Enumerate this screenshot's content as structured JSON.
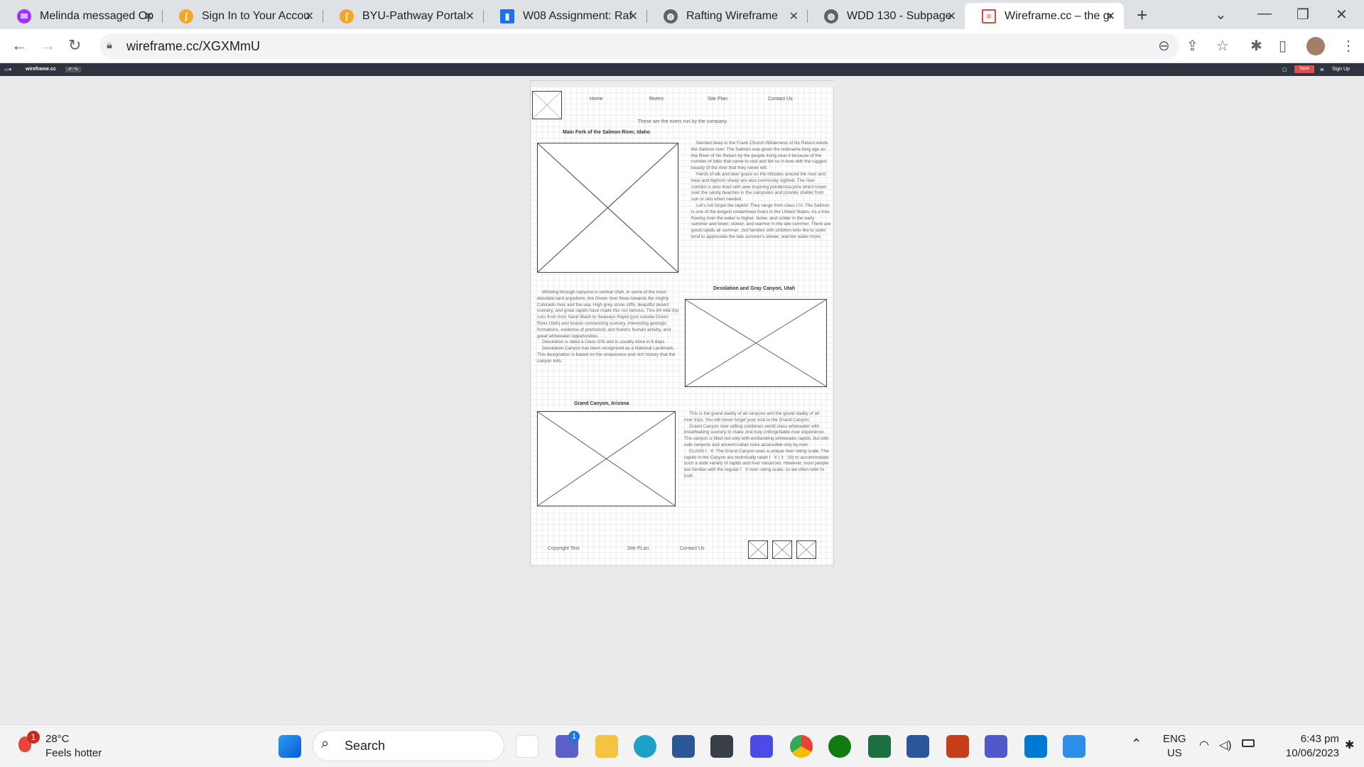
{
  "browser": {
    "tabs": [
      {
        "title": "Melinda messaged Op",
        "icon": "messenger-icon",
        "color": "#a033ff"
      },
      {
        "title": "Sign In to Your Accou",
        "icon": "pathway-icon",
        "color": "#f5a623"
      },
      {
        "title": "BYU-Pathway Portal",
        "icon": "pathway-icon",
        "color": "#f5a623"
      },
      {
        "title": "W08 Assignment: Raf",
        "icon": "canvas-icon",
        "color": "#1a73e8"
      },
      {
        "title": "Rafting Wireframe",
        "icon": "globe-icon",
        "color": "#5f6368"
      },
      {
        "title": "WDD 130 - Subpage",
        "icon": "globe-icon",
        "color": "#5f6368"
      },
      {
        "title": "Wireframe.cc – the go",
        "icon": "wireframe-icon",
        "color": "#e8453c",
        "active": true
      }
    ],
    "url": "wireframe.cc/XGXMmU"
  },
  "app": {
    "logo": "wireframe.cc",
    "save_label": "Save",
    "signup_label": "Sign Up"
  },
  "wireframe": {
    "nav": [
      "Home",
      "Rivers",
      "Site Plan",
      "Contact Us"
    ],
    "intro": "These are the rivers run by the company.",
    "sections": [
      {
        "heading": "Main Fork of the Salmon River, Idaho",
        "text": "    Nestled deep in the Frank Church Wilderness of No Return winds the Salmon river. The Salmon was given the nickname long ago as the River of No Return by the people living near it because of the number of folks that came to visit and fell so in love with the rugged beauty of the river that they never left.\n    Herds of elk and deer graze on the hillsides around the river and bear and bighorn sheep are also commonly sighted. The river corridor is also lined with awe inspiring ponderosa pine which tower over the sandy beaches in the campsites and provide shelter from sun or rain when needed.\n    Let's not forget the rapids! They range from class I IV. The Salmon is one of the longest undammed rivers in the United States. As a free flowing river the water is higher, faster, and colder in the early summer and lower, slower, and warmer in the late summer. There are good rapids all summer...but families with children who like to swim tend to appreciate the late summer's slower, warmer water more."
      },
      {
        "heading": "Desolation and Gray Canyon, Utah",
        "text": "    Winding through canyons in central Utah, in some of the most desolate land anywhere, the Green river flows towards the mighty Colorado river and the sea. High grey stone cliffs, beautiful desert scenery, and great rapids have made this run famous. This 84 mile trip runs from from Sand Wash to Swaseys Rapid (just outside Green River Utah) and boasts outstanding scenery, interesting geologic formations, evidence of prehistoric and historic human activity, and great whitewater opportunities.\n    Desolation is rated a Class II/III and is usually done in 6 days\n    Desolation Canyon has been recognized as a National Landmark. This designation is based on the uniqueness and rich history that the canyon tells."
      },
      {
        "heading": "Grand Canyon, Arizona",
        "text": "    This is the grand daddy of all canyons and the grand daddy of all river trips. You will never forget your visit to the Grand Canyon.\n    Grand Canyon river rafting combines world class whitewater with breathtaking scenery to make one truly unforgettable river experience. The canyon is filled not only with exhilarating whitewater rapids, but with side canyons and ancient indian ruins accessible only by river.\n    CLASS I   X: The Grand Canyon uses a unique river rating scale. The rapids in the Canyon are technically rated I   X ( 1   10) to accommodate such a wide variety of rapids and river variances. However, most people are familiar with the regular I   V river rating scale, so we often refer to both."
      }
    ],
    "footer": [
      "Copyright Text",
      "Site PLan",
      "Contact Us"
    ]
  },
  "taskbar": {
    "weather_temp": "28°C",
    "weather_desc": "Feels hotter",
    "weather_badge": "1",
    "search_label": "Search",
    "chat_badge": "1",
    "lang_top": "ENG",
    "lang_bottom": "US",
    "time": "6:43 pm",
    "date": "10/06/2023"
  }
}
